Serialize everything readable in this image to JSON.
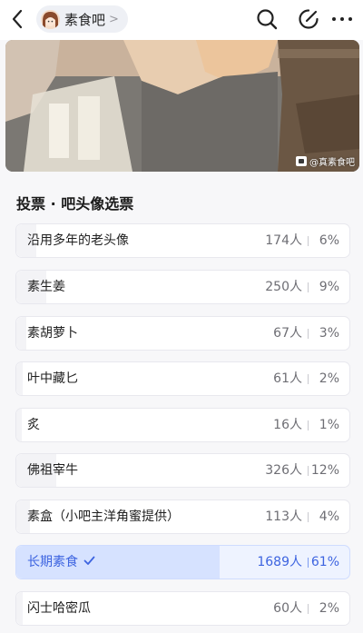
{
  "header": {
    "forum_name": "素食吧",
    "chip_arrow": ">",
    "icons": [
      "back-arrow-icon",
      "search-icon",
      "edit-icon",
      "more-icon"
    ]
  },
  "hero": {
    "watermark": "@真素食吧"
  },
  "poll": {
    "title": "投票 · 吧头像选票",
    "selected_color": "#3d64e0",
    "options": [
      {
        "label": "沿用多年的老头像",
        "count": "174人",
        "percent": "6%",
        "fraction": 0.06,
        "selected": false
      },
      {
        "label": "素生姜",
        "count": "250人",
        "percent": "9%",
        "fraction": 0.09,
        "selected": false
      },
      {
        "label": "素胡萝卜",
        "count": "67人",
        "percent": "3%",
        "fraction": 0.03,
        "selected": false
      },
      {
        "label": "叶中藏匕",
        "count": "61人",
        "percent": "2%",
        "fraction": 0.02,
        "selected": false
      },
      {
        "label": "炙",
        "count": "16人",
        "percent": "1%",
        "fraction": 0.01,
        "selected": false
      },
      {
        "label": "佛祖宰牛",
        "count": "326人",
        "percent": "12%",
        "fraction": 0.12,
        "selected": false
      },
      {
        "label": "素盒（小吧主洋角蜜提供）",
        "count": "113人",
        "percent": "4%",
        "fraction": 0.04,
        "selected": false
      },
      {
        "label": "长期素食",
        "count": "1689人",
        "percent": "61%",
        "fraction": 0.61,
        "selected": true
      },
      {
        "label": "闪士哈密瓜",
        "count": "60人",
        "percent": "2%",
        "fraction": 0.02,
        "selected": false
      }
    ]
  }
}
